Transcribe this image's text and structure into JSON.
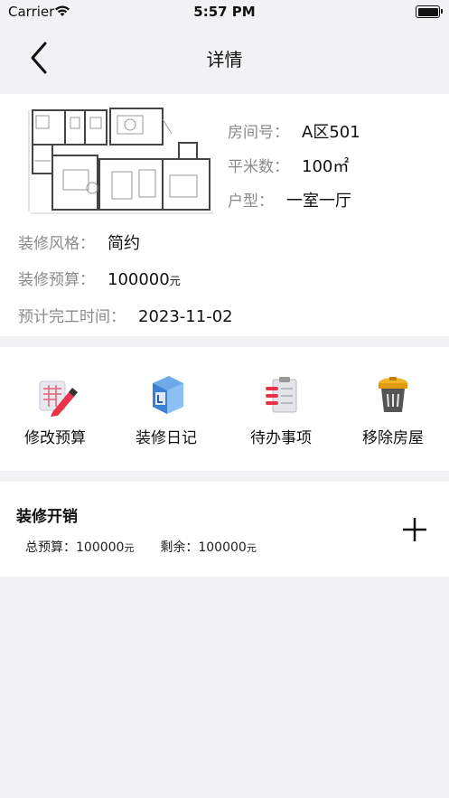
{
  "status_bar": {
    "carrier": "Carrier",
    "time": "5:57 PM"
  },
  "nav": {
    "title": "详情"
  },
  "house": {
    "room_label": "房间号：",
    "room_value": "A区501",
    "area_label": "平米数：",
    "area_value": "100㎡",
    "layout_label": "户型：",
    "layout_value": "一室一厅",
    "style_label": "装修风格：",
    "style_value": "简约",
    "budget_label": "装修预算：",
    "budget_value": "100000",
    "budget_unit": "元",
    "finish_label": "预计完工时间：",
    "finish_value": "2023-11-02"
  },
  "actions": [
    {
      "label": "修改预算",
      "icon": "edit-budget-icon"
    },
    {
      "label": "装修日记",
      "icon": "diary-clock-icon"
    },
    {
      "label": "待办事项",
      "icon": "todo-clipboard-icon"
    },
    {
      "label": "移除房屋",
      "icon": "trash-bin-icon"
    }
  ],
  "expenses": {
    "title": "装修开销",
    "total_label": "总预算：",
    "total_value": "100000",
    "total_unit": "元",
    "remain_label": "剩余：",
    "remain_value": "100000",
    "remain_unit": "元"
  },
  "colors": {
    "background": "#f2f2f4",
    "card": "#ffffff",
    "label_gray": "#8a8a8a"
  }
}
